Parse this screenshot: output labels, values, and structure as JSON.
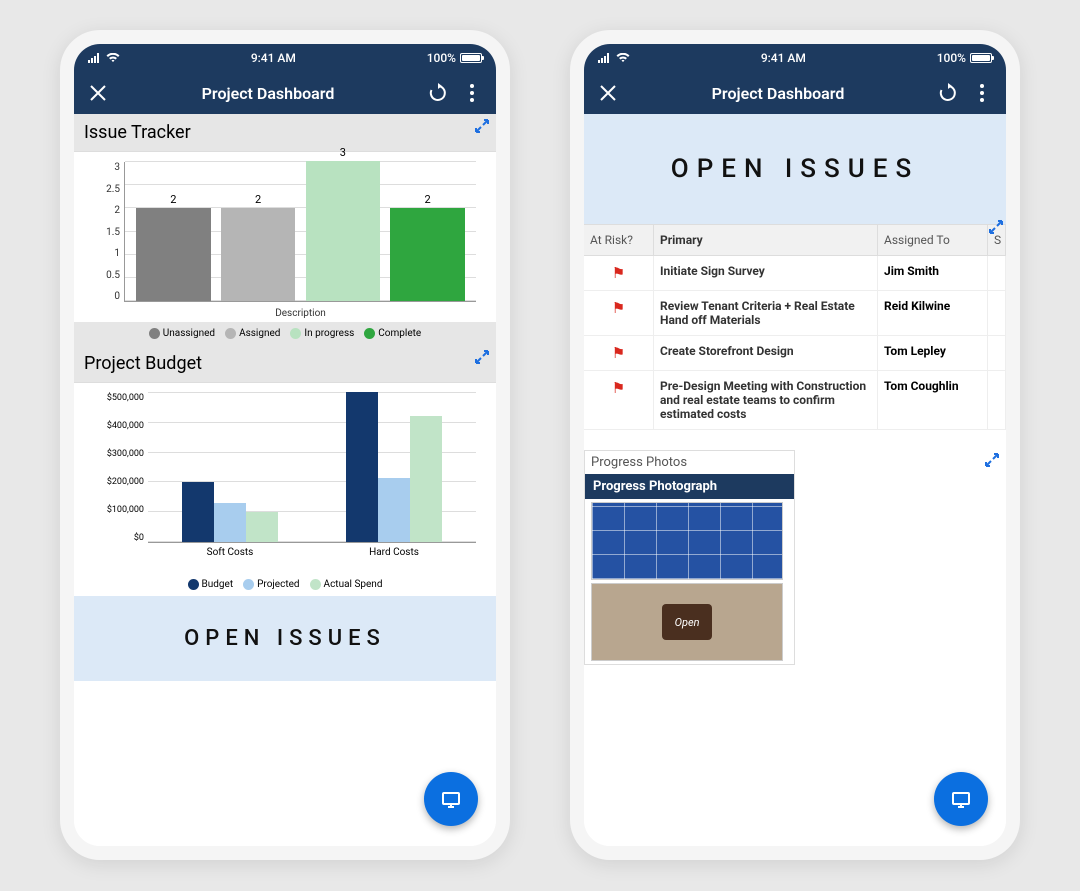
{
  "status": {
    "time": "9:41 AM",
    "battery": "100%"
  },
  "nav": {
    "title": "Project Dashboard"
  },
  "phone1": {
    "issue_tracker": {
      "title": "Issue Tracker"
    },
    "project_budget": {
      "title": "Project Budget"
    },
    "open_issues": {
      "label": "OPEN ISSUES"
    }
  },
  "phone2": {
    "open_issues": {
      "label": "OPEN ISSUES"
    },
    "table": {
      "headers": {
        "risk": "At Risk?",
        "primary": "Primary",
        "assigned": "Assigned To"
      },
      "rows": [
        {
          "flag": true,
          "primary": "Initiate Sign Survey",
          "assigned": "Jim Smith"
        },
        {
          "flag": true,
          "primary": "Review Tenant Criteria + Real Estate Hand off Materials",
          "assigned": "Reid Kilwine"
        },
        {
          "flag": true,
          "primary": "Create Storefront Design",
          "assigned": "Tom Lepley"
        },
        {
          "flag": true,
          "primary": "Pre-Design Meeting with Construction and real estate teams to confirm estimated costs",
          "assigned": "Tom Coughlin"
        }
      ]
    },
    "progress": {
      "title": "Progress Photos",
      "sub": "Progress Photograph",
      "open_sign": "Open"
    }
  },
  "chart_data": [
    {
      "type": "bar",
      "title": "Issue Tracker",
      "xlabel": "Description",
      "categories": [
        "Unassigned",
        "Assigned",
        "In progress",
        "Complete"
      ],
      "values": [
        2,
        2,
        3,
        2
      ],
      "colors": [
        "#808080",
        "#b5b5b5",
        "#b8e2c0",
        "#2fa63f"
      ],
      "ylim": [
        0,
        3
      ],
      "ytick": 0.5
    },
    {
      "type": "bar",
      "title": "Project Budget",
      "categories": [
        "Soft Costs",
        "Hard Costs"
      ],
      "series": [
        {
          "name": "Budget",
          "values": [
            200000,
            500000
          ],
          "color": "#13386d"
        },
        {
          "name": "Projected",
          "values": [
            130000,
            215000
          ],
          "color": "#a8cdee"
        },
        {
          "name": "Actual Spend",
          "values": [
            100000,
            420000
          ],
          "color": "#c1e4c8"
        }
      ],
      "ylim": [
        0,
        500000
      ],
      "ytick": 100000,
      "yformat": "currency"
    }
  ]
}
